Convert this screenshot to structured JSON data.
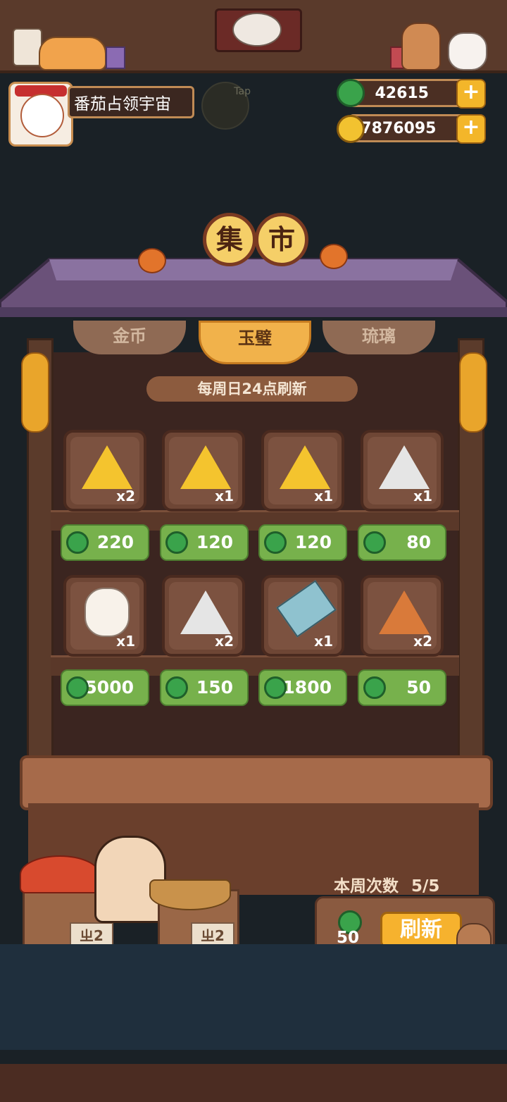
{
  "header": {
    "player_name": "番茄占领宇宙",
    "tap_label": "Tap",
    "jade_amount": "42615",
    "coin_amount": "27876095",
    "plus_label": "+"
  },
  "market": {
    "title_chars": [
      "集",
      "市"
    ],
    "tabs": [
      {
        "label": "金币",
        "active": false
      },
      {
        "label": "玉璧",
        "active": true
      },
      {
        "label": "琉璃",
        "active": false
      }
    ],
    "refresh_note": "每周日24点刷新",
    "items_row1": [
      {
        "icon": "yellow-triangle-fish",
        "qty": "x2",
        "price": "220"
      },
      {
        "icon": "yellow-triangle-star",
        "qty": "x1",
        "price": "120"
      },
      {
        "icon": "yellow-triangle-antler",
        "qty": "x1",
        "price": "120"
      },
      {
        "icon": "white-triangle-snake",
        "qty": "x1",
        "price": "80"
      }
    ],
    "items_row2": [
      {
        "icon": "bear-musician",
        "qty": "x1",
        "price": "25000"
      },
      {
        "icon": "white-triangle-symbol",
        "qty": "x2",
        "price": "150"
      },
      {
        "icon": "paper-umbrella",
        "qty": "x1",
        "price": "1800"
      },
      {
        "icon": "orange-triangle-spiral",
        "qty": "x2",
        "price": "50"
      }
    ],
    "weekly_count_label": "本周次数",
    "weekly_count_value": "5/5",
    "refresh_cost": "50",
    "refresh_label": "刷新",
    "stall_sign_left": "ㄓ2",
    "stall_sign_right": "ㄓ2"
  },
  "colors": {
    "jade": "#3aa34b",
    "gold": "#f2c230",
    "price_green": "#77b14c",
    "tab_active": "#f1b24b"
  }
}
